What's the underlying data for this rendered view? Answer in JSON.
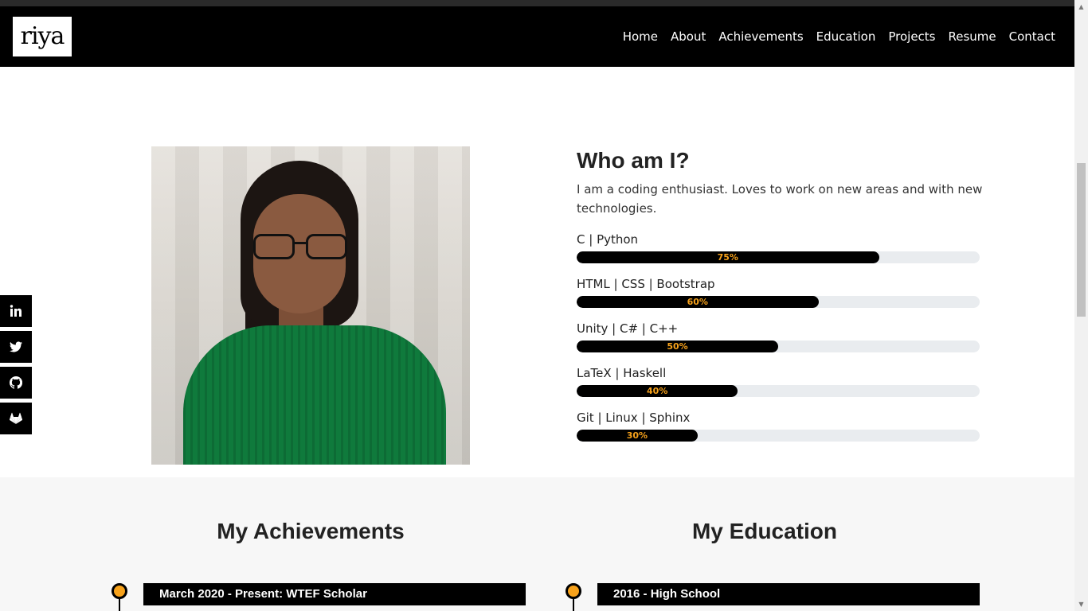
{
  "brand": {
    "logo_text": "riya"
  },
  "nav": {
    "items": [
      {
        "label": "Home"
      },
      {
        "label": "About"
      },
      {
        "label": "Achievements"
      },
      {
        "label": "Education"
      },
      {
        "label": "Projects"
      },
      {
        "label": "Resume"
      },
      {
        "label": "Contact"
      }
    ]
  },
  "about": {
    "title": "Who am I?",
    "description": "I am a coding enthusiast. Loves to work on new areas and with new technologies.",
    "skills": [
      {
        "label": "C | Python",
        "percent": 75,
        "percent_label": "75%"
      },
      {
        "label": "HTML | CSS | Bootstrap",
        "percent": 60,
        "percent_label": "60%"
      },
      {
        "label": "Unity | C# | C++",
        "percent": 50,
        "percent_label": "50%"
      },
      {
        "label": "LaTeX | Haskell",
        "percent": 40,
        "percent_label": "40%"
      },
      {
        "label": "Git | Linux | Sphinx",
        "percent": 30,
        "percent_label": "30%"
      }
    ]
  },
  "social": [
    "linkedin-icon",
    "twitter-icon",
    "github-icon",
    "gitlab-icon"
  ],
  "achievements": {
    "title": "My Achievements",
    "items": [
      {
        "label": "March 2020 - Present: WTEF Scholar"
      }
    ]
  },
  "education": {
    "title": "My Education",
    "items": [
      {
        "label": "2016 - High School"
      }
    ]
  },
  "colors": {
    "accent": "#f7a21b",
    "bar_track": "#e9ecef",
    "bar_fill": "#000000",
    "section_bg": "#f7f7f7"
  }
}
